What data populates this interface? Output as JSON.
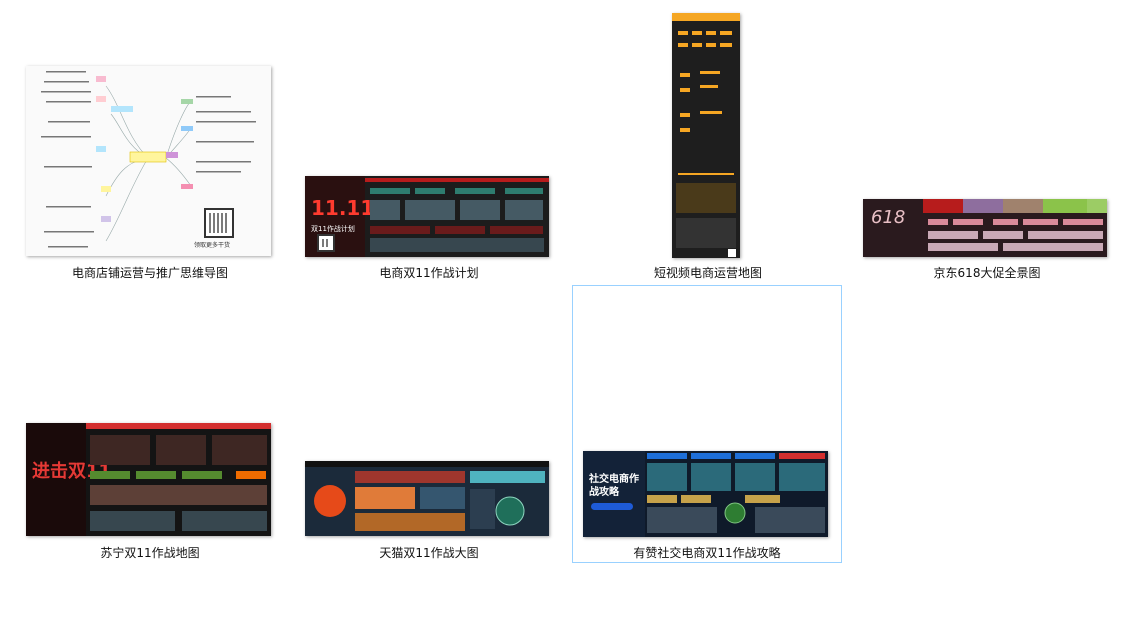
{
  "files": [
    {
      "name": "电商店铺运营与推广思维导图",
      "thumb_text": "领取更多干货"
    },
    {
      "name": "电商双11作战计划",
      "thumb_text": "双11作战计划"
    },
    {
      "name": "短视频电商运营地图"
    },
    {
      "name": "京东618大促全景图",
      "thumb_text": "618"
    },
    {
      "name": "苏宁双11作战地图",
      "thumb_text": "进击双11"
    },
    {
      "name": "天猫双11作战大图"
    },
    {
      "name": "有赞社交电商双11作战攻略",
      "thumb_text": "社交电商作战攻略",
      "selected": true
    }
  ],
  "icons": {
    "mindmap": "mindmap-thumbnail",
    "poster": "poster-thumbnail"
  }
}
